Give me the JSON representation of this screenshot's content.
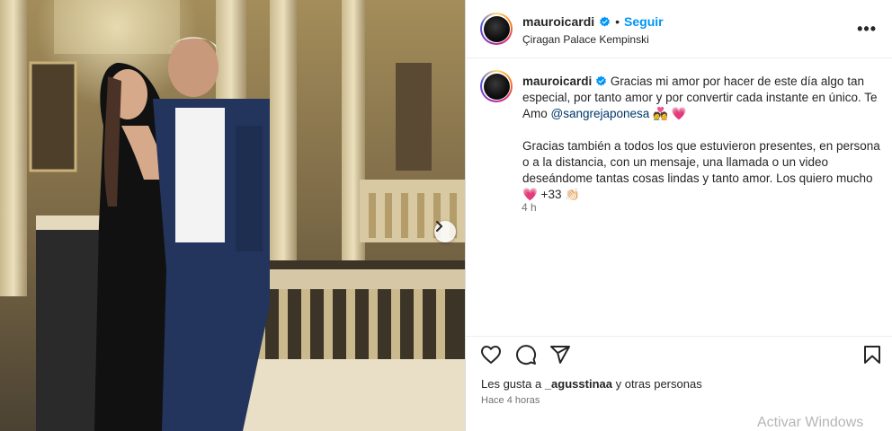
{
  "post": {
    "username": "mauroicardi",
    "separator": "•",
    "follow_label": "Seguir",
    "location": "Çiragan Palace Kempinski",
    "more_label": "•••",
    "caption_username": "mauroicardi",
    "caption_line1": "Gracias mi amor por hacer de este día algo tan especial, por tanto amor y por convertir cada instante en único. Te Amo ",
    "caption_mention": "@sangrejaponesa",
    "caption_line1_end": " 💑 💗",
    "caption_line2": "Gracias también a todos los que estuvieron presentes, en persona o a la distancia, con un mensaje, una llamada o un video deseándome tantas cosas lindas y tanto amor. Los quiero mucho",
    "caption_line2_end": "💗 +33 👏🏻",
    "caption_age": "4 h",
    "likes_prefix": "Les gusta a ",
    "likes_user": "_agusstinaa",
    "likes_suffix": " y otras personas",
    "posted": "Hace 4 horas"
  },
  "icons": {
    "like": "heart-icon",
    "comment": "comment-icon",
    "share": "share-icon",
    "save": "bookmark-icon",
    "next": "chevron-right-icon",
    "verified": "verified-badge-icon"
  },
  "colors": {
    "follow": "#0095f6",
    "verified": "#0095f6",
    "mention": "#00376b"
  },
  "watermark": "Activar Windows"
}
